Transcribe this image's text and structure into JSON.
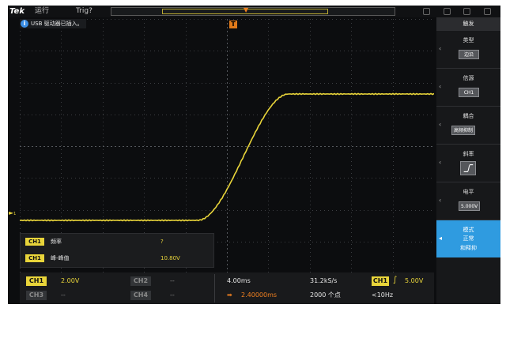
{
  "topbar": {
    "logo": "Tek",
    "run_status": "运行",
    "trigger_status": "Trig?"
  },
  "notification": {
    "icon": "info-icon",
    "text": "USB 驱动器已插入。"
  },
  "trigger_marker": "T",
  "channel_marker": "1",
  "measurements": [
    {
      "channel": "CH1",
      "name": "频率",
      "value": "?"
    },
    {
      "channel": "CH1",
      "name": "峰-峰值",
      "value": "10.80V"
    }
  ],
  "bottom_bar": {
    "ch1_label": "CH1",
    "ch1_scale": "2.00V",
    "ch2_label": "CH2",
    "ch2_scale": "--",
    "ch3_label": "CH3",
    "ch3_scale": "--",
    "ch4_label": "CH4",
    "ch4_scale": "--",
    "timebase": "4.00ms",
    "sample_rate": "31.2kS/s",
    "trigger_source": "CH1",
    "trigger_level": "5.00V",
    "horizontal_position": "2.40000ms",
    "record_length": "2000 个点",
    "trigger_frequency": "<10Hz"
  },
  "side_menu": {
    "title": "触发",
    "items": [
      {
        "label": "类型",
        "value": "边沿"
      },
      {
        "label": "信源",
        "value": "CH1"
      },
      {
        "label": "耦合",
        "value": "高频抑制"
      },
      {
        "label": "斜率",
        "value": "rising-edge-icon"
      },
      {
        "label": "电平",
        "value": "5.000V"
      }
    ],
    "mode": {
      "label": "模式",
      "line1": "正常",
      "line2": "和释抑"
    }
  },
  "colors": {
    "ch1": "#e8d43a",
    "trigger": "#e07a1a",
    "menu_active": "#2f9be0",
    "background": "#0c0d0f"
  }
}
